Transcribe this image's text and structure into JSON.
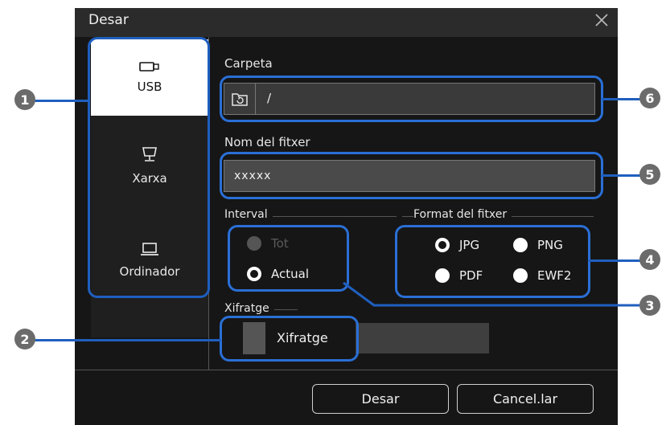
{
  "dialog": {
    "title": "Desar"
  },
  "sidebar": {
    "items": [
      {
        "label": "USB",
        "icon": "usb-icon",
        "active": true
      },
      {
        "label": "Xarxa",
        "icon": "network-icon",
        "active": false
      },
      {
        "label": "Ordinador",
        "icon": "laptop-icon",
        "active": false
      }
    ]
  },
  "folder": {
    "label": "Carpeta",
    "value": "/"
  },
  "filename": {
    "label": "Nom del fitxer",
    "value": "xxxxx"
  },
  "interval": {
    "label": "Interval",
    "options": [
      "Tot",
      "Actual"
    ],
    "selected": "Actual",
    "disabled": [
      "Tot"
    ]
  },
  "format": {
    "label": "Format del fitxer",
    "options": [
      "JPG",
      "PNG",
      "PDF",
      "EWF2"
    ],
    "selected": "JPG"
  },
  "encryption": {
    "label": "Xifratge",
    "checkbox_label": "Xifratge",
    "checked": false
  },
  "buttons": {
    "save": "Desar",
    "cancel": "Cancel.lar"
  },
  "callouts": [
    "1",
    "2",
    "3",
    "4",
    "5",
    "6"
  ],
  "colors": {
    "callout": "#1f5fbf",
    "badge": "#6b6b6b",
    "dialog_bg": "#161616"
  }
}
